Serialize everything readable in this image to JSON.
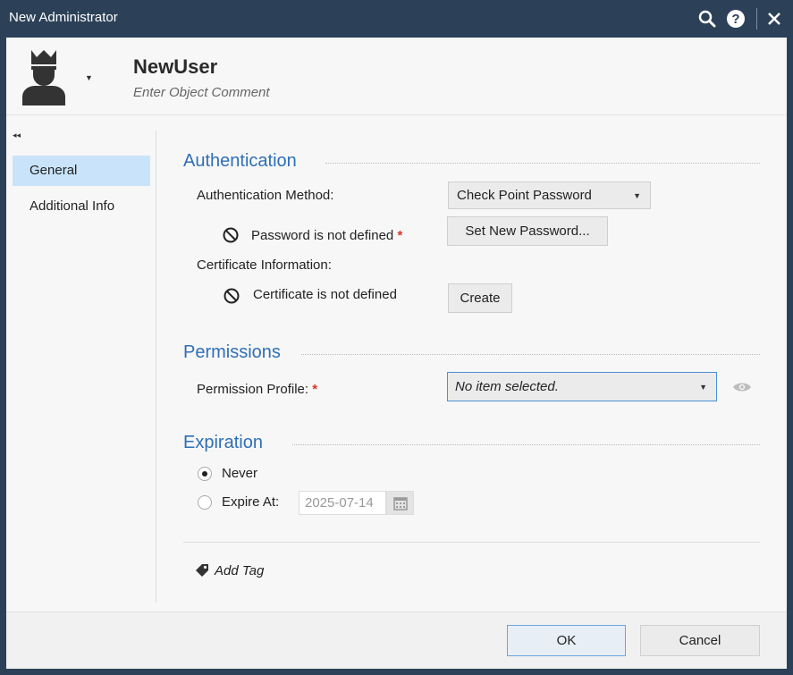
{
  "window": {
    "title": "New Administrator"
  },
  "header": {
    "name": "NewUser",
    "comment_placeholder": "Enter Object Comment",
    "avatar_icon": "admin-crown-user-icon"
  },
  "sidebar": {
    "items": [
      {
        "label": "General",
        "active": true
      },
      {
        "label": "Additional Info",
        "active": false
      }
    ]
  },
  "authentication": {
    "title": "Authentication",
    "method_label": "Authentication Method:",
    "method_value": "Check Point Password",
    "password_status": "Password is not defined",
    "required_mark": "*",
    "set_password_label": "Set New Password...",
    "certificate_label": "Certificate Information:",
    "certificate_status": "Certificate is not defined",
    "create_label": "Create"
  },
  "permissions": {
    "title": "Permissions",
    "profile_label": "Permission Profile:",
    "required_mark": "*",
    "profile_value": "No item selected."
  },
  "expiration": {
    "title": "Expiration",
    "never_label": "Never",
    "never_checked": true,
    "expire_label": "Expire At:",
    "expire_checked": false,
    "expire_date": "2025-07-14"
  },
  "tags": {
    "add_tag_label": "Add Tag"
  },
  "footer": {
    "ok_label": "OK",
    "cancel_label": "Cancel"
  },
  "colors": {
    "titlebar": "#2c4158",
    "section_title": "#2f6fb5",
    "nav_active": "#c9e4fa",
    "required": "#d9342b"
  }
}
